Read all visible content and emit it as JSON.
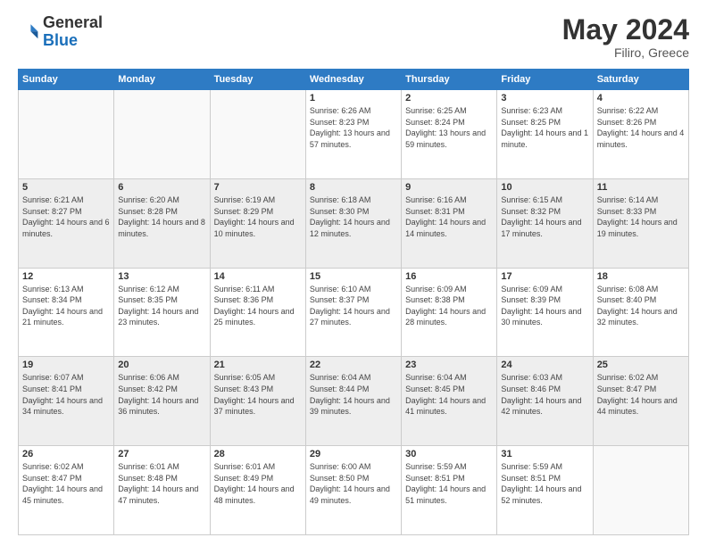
{
  "header": {
    "logo_general": "General",
    "logo_blue": "Blue",
    "title": "May 2024",
    "location": "Filiro, Greece"
  },
  "weekdays": [
    "Sunday",
    "Monday",
    "Tuesday",
    "Wednesday",
    "Thursday",
    "Friday",
    "Saturday"
  ],
  "weeks": [
    [
      {
        "day": "",
        "sunrise": "",
        "sunset": "",
        "daylight": ""
      },
      {
        "day": "",
        "sunrise": "",
        "sunset": "",
        "daylight": ""
      },
      {
        "day": "",
        "sunrise": "",
        "sunset": "",
        "daylight": ""
      },
      {
        "day": "1",
        "sunrise": "Sunrise: 6:26 AM",
        "sunset": "Sunset: 8:23 PM",
        "daylight": "Daylight: 13 hours and 57 minutes."
      },
      {
        "day": "2",
        "sunrise": "Sunrise: 6:25 AM",
        "sunset": "Sunset: 8:24 PM",
        "daylight": "Daylight: 13 hours and 59 minutes."
      },
      {
        "day": "3",
        "sunrise": "Sunrise: 6:23 AM",
        "sunset": "Sunset: 8:25 PM",
        "daylight": "Daylight: 14 hours and 1 minute."
      },
      {
        "day": "4",
        "sunrise": "Sunrise: 6:22 AM",
        "sunset": "Sunset: 8:26 PM",
        "daylight": "Daylight: 14 hours and 4 minutes."
      }
    ],
    [
      {
        "day": "5",
        "sunrise": "Sunrise: 6:21 AM",
        "sunset": "Sunset: 8:27 PM",
        "daylight": "Daylight: 14 hours and 6 minutes."
      },
      {
        "day": "6",
        "sunrise": "Sunrise: 6:20 AM",
        "sunset": "Sunset: 8:28 PM",
        "daylight": "Daylight: 14 hours and 8 minutes."
      },
      {
        "day": "7",
        "sunrise": "Sunrise: 6:19 AM",
        "sunset": "Sunset: 8:29 PM",
        "daylight": "Daylight: 14 hours and 10 minutes."
      },
      {
        "day": "8",
        "sunrise": "Sunrise: 6:18 AM",
        "sunset": "Sunset: 8:30 PM",
        "daylight": "Daylight: 14 hours and 12 minutes."
      },
      {
        "day": "9",
        "sunrise": "Sunrise: 6:16 AM",
        "sunset": "Sunset: 8:31 PM",
        "daylight": "Daylight: 14 hours and 14 minutes."
      },
      {
        "day": "10",
        "sunrise": "Sunrise: 6:15 AM",
        "sunset": "Sunset: 8:32 PM",
        "daylight": "Daylight: 14 hours and 17 minutes."
      },
      {
        "day": "11",
        "sunrise": "Sunrise: 6:14 AM",
        "sunset": "Sunset: 8:33 PM",
        "daylight": "Daylight: 14 hours and 19 minutes."
      }
    ],
    [
      {
        "day": "12",
        "sunrise": "Sunrise: 6:13 AM",
        "sunset": "Sunset: 8:34 PM",
        "daylight": "Daylight: 14 hours and 21 minutes."
      },
      {
        "day": "13",
        "sunrise": "Sunrise: 6:12 AM",
        "sunset": "Sunset: 8:35 PM",
        "daylight": "Daylight: 14 hours and 23 minutes."
      },
      {
        "day": "14",
        "sunrise": "Sunrise: 6:11 AM",
        "sunset": "Sunset: 8:36 PM",
        "daylight": "Daylight: 14 hours and 25 minutes."
      },
      {
        "day": "15",
        "sunrise": "Sunrise: 6:10 AM",
        "sunset": "Sunset: 8:37 PM",
        "daylight": "Daylight: 14 hours and 27 minutes."
      },
      {
        "day": "16",
        "sunrise": "Sunrise: 6:09 AM",
        "sunset": "Sunset: 8:38 PM",
        "daylight": "Daylight: 14 hours and 28 minutes."
      },
      {
        "day": "17",
        "sunrise": "Sunrise: 6:09 AM",
        "sunset": "Sunset: 8:39 PM",
        "daylight": "Daylight: 14 hours and 30 minutes."
      },
      {
        "day": "18",
        "sunrise": "Sunrise: 6:08 AM",
        "sunset": "Sunset: 8:40 PM",
        "daylight": "Daylight: 14 hours and 32 minutes."
      }
    ],
    [
      {
        "day": "19",
        "sunrise": "Sunrise: 6:07 AM",
        "sunset": "Sunset: 8:41 PM",
        "daylight": "Daylight: 14 hours and 34 minutes."
      },
      {
        "day": "20",
        "sunrise": "Sunrise: 6:06 AM",
        "sunset": "Sunset: 8:42 PM",
        "daylight": "Daylight: 14 hours and 36 minutes."
      },
      {
        "day": "21",
        "sunrise": "Sunrise: 6:05 AM",
        "sunset": "Sunset: 8:43 PM",
        "daylight": "Daylight: 14 hours and 37 minutes."
      },
      {
        "day": "22",
        "sunrise": "Sunrise: 6:04 AM",
        "sunset": "Sunset: 8:44 PM",
        "daylight": "Daylight: 14 hours and 39 minutes."
      },
      {
        "day": "23",
        "sunrise": "Sunrise: 6:04 AM",
        "sunset": "Sunset: 8:45 PM",
        "daylight": "Daylight: 14 hours and 41 minutes."
      },
      {
        "day": "24",
        "sunrise": "Sunrise: 6:03 AM",
        "sunset": "Sunset: 8:46 PM",
        "daylight": "Daylight: 14 hours and 42 minutes."
      },
      {
        "day": "25",
        "sunrise": "Sunrise: 6:02 AM",
        "sunset": "Sunset: 8:47 PM",
        "daylight": "Daylight: 14 hours and 44 minutes."
      }
    ],
    [
      {
        "day": "26",
        "sunrise": "Sunrise: 6:02 AM",
        "sunset": "Sunset: 8:47 PM",
        "daylight": "Daylight: 14 hours and 45 minutes."
      },
      {
        "day": "27",
        "sunrise": "Sunrise: 6:01 AM",
        "sunset": "Sunset: 8:48 PM",
        "daylight": "Daylight: 14 hours and 47 minutes."
      },
      {
        "day": "28",
        "sunrise": "Sunrise: 6:01 AM",
        "sunset": "Sunset: 8:49 PM",
        "daylight": "Daylight: 14 hours and 48 minutes."
      },
      {
        "day": "29",
        "sunrise": "Sunrise: 6:00 AM",
        "sunset": "Sunset: 8:50 PM",
        "daylight": "Daylight: 14 hours and 49 minutes."
      },
      {
        "day": "30",
        "sunrise": "Sunrise: 5:59 AM",
        "sunset": "Sunset: 8:51 PM",
        "daylight": "Daylight: 14 hours and 51 minutes."
      },
      {
        "day": "31",
        "sunrise": "Sunrise: 5:59 AM",
        "sunset": "Sunset: 8:51 PM",
        "daylight": "Daylight: 14 hours and 52 minutes."
      },
      {
        "day": "",
        "sunrise": "",
        "sunset": "",
        "daylight": ""
      }
    ]
  ]
}
